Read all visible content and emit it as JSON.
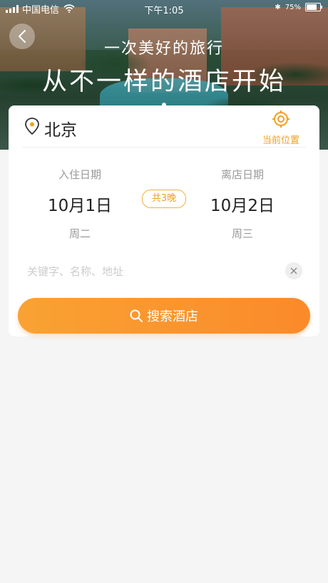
{
  "status_bar": {
    "carrier": "中国电信",
    "time": "下午1:05",
    "battery": "75%",
    "battery_level": 0.75
  },
  "hero": {
    "subtitle": "一次美好的旅行",
    "title": "从不一样的酒店开始"
  },
  "location": {
    "city": "北京",
    "current_location_label": "当前位置"
  },
  "dates": {
    "checkin_label": "入住日期",
    "checkin_date": "10月1日",
    "checkin_weekday": "周二",
    "nights": "共3晚",
    "checkout_label": "离店日期",
    "checkout_date": "10月2日",
    "checkout_weekday": "周三"
  },
  "search": {
    "keyword_placeholder": "关键字、名称、地址",
    "keyword_value": "",
    "button_label": "搜索酒店"
  },
  "colors": {
    "accent": "#f0a020",
    "button_gradient_start": "#f9a233",
    "button_gradient_end": "#fb8a2a"
  },
  "icons": {
    "back": "chevron-left-icon",
    "pin": "map-pin-icon",
    "target": "crosshair-icon",
    "clear": "close-icon",
    "search": "search-icon"
  }
}
